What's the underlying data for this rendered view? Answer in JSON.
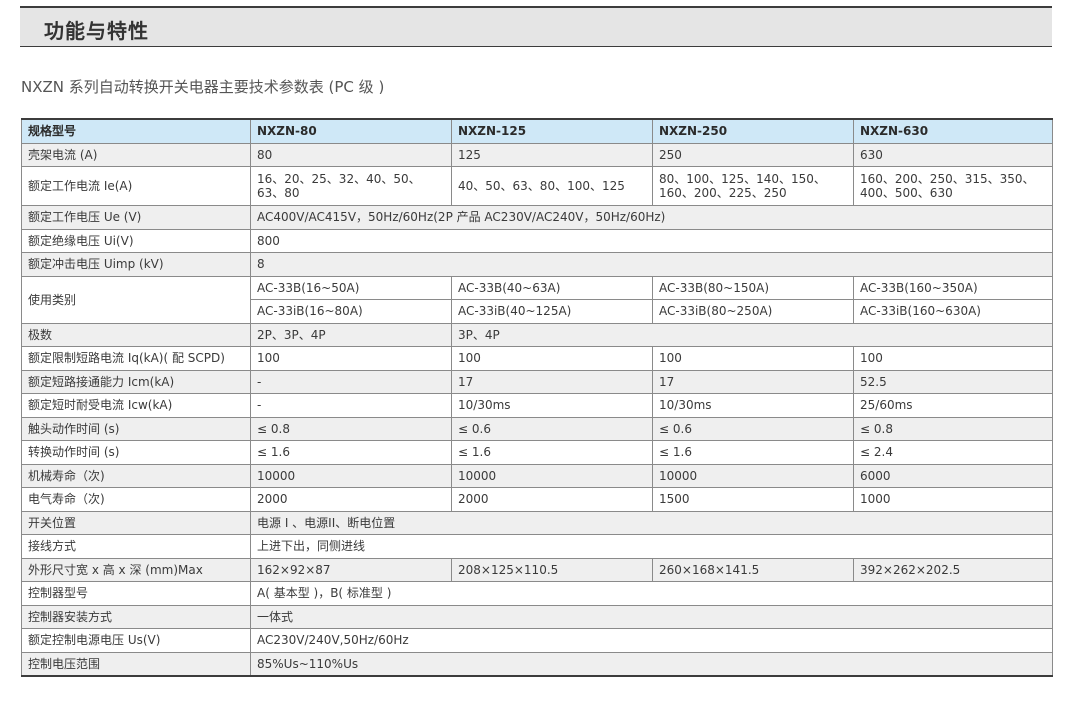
{
  "section_title": "功能与特性",
  "table_title": "NXZN 系列自动转换开关电器主要技术参数表 (PC 级 )",
  "headers": [
    "规格型号",
    "NXZN-80",
    "NXZN-125",
    "NXZN-250",
    "NXZN-630"
  ],
  "rows": {
    "frame_current": {
      "label": "壳架电流 (A)",
      "values": [
        "80",
        "125",
        "250",
        "630"
      ]
    },
    "rated_current": {
      "label": "额定工作电流 Ie(A)",
      "values": [
        "16、20、25、32、40、50、63、80",
        "40、50、63、80、100、125",
        "80、100、125、140、150、160、200、225、250",
        "160、200、250、315、350、400、500、630"
      ]
    },
    "rated_voltage": {
      "label": "额定工作电压 Ue (V)",
      "value": "AC400V/AC415V，50Hz/60Hz(2P 产品 AC230V/AC240V，50Hz/60Hz)"
    },
    "insulation_voltage": {
      "label": "额定绝缘电压 Ui(V)",
      "value": "800"
    },
    "impulse_voltage": {
      "label": "额定冲击电压 Uimp (kV)",
      "value": "8"
    },
    "utilization": {
      "label": "使用类别",
      "values_a": [
        "AC-33B(16~50A)",
        "AC-33B(40~63A)",
        "AC-33B(80~150A)",
        "AC-33B(160~350A)"
      ],
      "values_b": [
        "AC-33iB(16~80A)",
        "AC-33iB(40~125A)",
        "AC-33iB(80~250A)",
        "AC-33iB(160~630A)"
      ]
    },
    "poles": {
      "label": "极数",
      "values": [
        "2P、3P、4P",
        "3P、4P"
      ]
    },
    "limit_short_circuit": {
      "label": "额定限制短路电流 Iq(kA)( 配 SCPD)",
      "values": [
        "100",
        "100",
        "100",
        "100"
      ]
    },
    "making_capacity": {
      "label": "额定短路接通能力 Icm(kA)",
      "values": [
        "-",
        "17",
        "17",
        "52.5"
      ]
    },
    "withstand_current": {
      "label": "额定短时耐受电流 Icw(kA)",
      "values": [
        "-",
        "10/30ms",
        "10/30ms",
        "25/60ms"
      ]
    },
    "contact_time": {
      "label": "触头动作时间 (s)",
      "values": [
        "≤ 0.8",
        "≤ 0.6",
        "≤ 0.6",
        "≤ 0.8"
      ]
    },
    "transfer_time": {
      "label": "转换动作时间 (s)",
      "values": [
        "≤ 1.6",
        "≤ 1.6",
        "≤ 1.6",
        "≤ 2.4"
      ]
    },
    "mechanical_life": {
      "label": "机械寿命（次)",
      "values": [
        "10000",
        "10000",
        "10000",
        "6000"
      ]
    },
    "electrical_life": {
      "label": "电气寿命（次)",
      "values": [
        "2000",
        "2000",
        "1500",
        "1000"
      ]
    },
    "switch_position": {
      "label": "开关位置",
      "value": "电源 I 、电源II、断电位置"
    },
    "wiring": {
      "label": "接线方式",
      "value": "上进下出，同侧进线"
    },
    "dimensions": {
      "label": "外形尺寸宽 x 高 x 深 (mm)Max",
      "values": [
        "162×92×87",
        "208×125×110.5",
        "260×168×141.5",
        "392×262×202.5"
      ]
    },
    "controller_model": {
      "label": "控制器型号",
      "value": "A( 基本型 )，B( 标准型 )"
    },
    "controller_mount": {
      "label": "控制器安装方式",
      "value": "一体式"
    },
    "control_voltage": {
      "label": "额定控制电源电压 Us(V)",
      "value": "AC230V/240V,50Hz/60Hz"
    },
    "control_range": {
      "label": "控制电压范围",
      "value": "85%Us~110%Us"
    }
  }
}
